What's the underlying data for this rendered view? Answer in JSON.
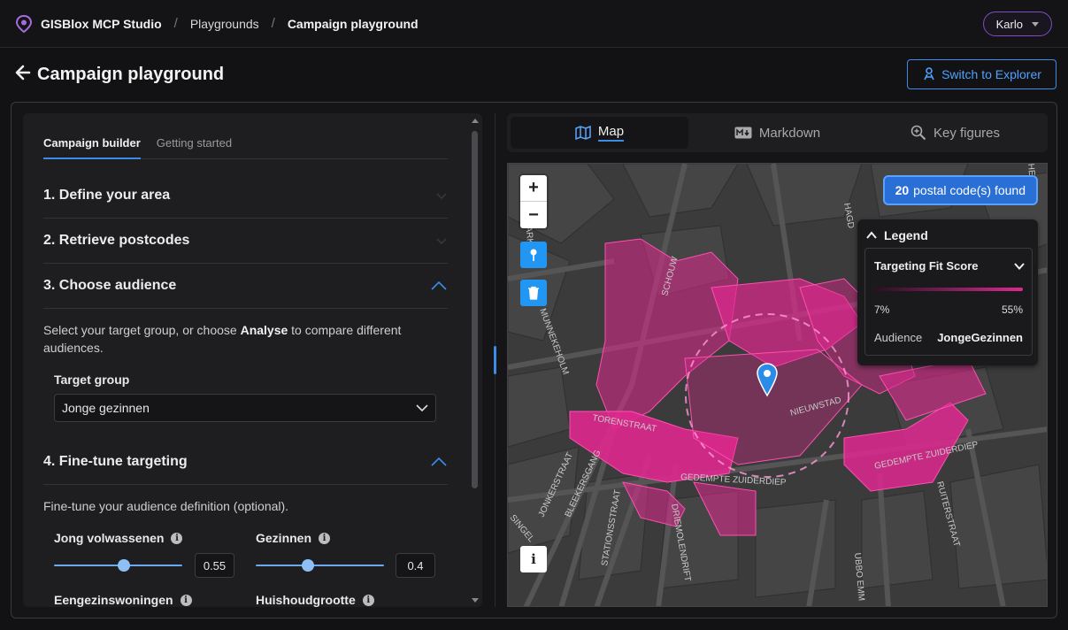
{
  "topbar": {
    "brand": "GISBlox MCP Studio",
    "crumbs": [
      "Playgrounds",
      "Campaign playground"
    ],
    "user": "Karlo"
  },
  "header": {
    "title": "Campaign playground",
    "explorer_button": "Switch to Explorer"
  },
  "builder": {
    "tabs": [
      "Campaign builder",
      "Getting started"
    ],
    "sections": [
      "1. Define your area",
      "2. Retrieve postcodes",
      "3. Choose audience",
      "4. Fine-tune targeting"
    ],
    "audience_desc_pre": "Select your target group, or choose ",
    "audience_desc_bold": "Analyse",
    "audience_desc_post": " to compare different audiences.",
    "target_group_label": "Target group",
    "target_group_value": "Jonge gezinnen",
    "finetune_desc": "Fine-tune your audience definition (optional).",
    "sliders": [
      {
        "label": "Jong volwassenen",
        "value": "0.55",
        "fraction": 0.55
      },
      {
        "label": "Gezinnen",
        "value": "0.4",
        "fraction": 0.4
      }
    ],
    "more_labels": [
      "Eengezinswoningen",
      "Huishoudgrootte"
    ]
  },
  "view_tabs": [
    "Map",
    "Markdown",
    "Key figures"
  ],
  "map": {
    "zoom_in": "+",
    "zoom_out": "−",
    "info": "i",
    "found_count": "20",
    "found_text": "postal code(s) found",
    "legend_title": "Legend",
    "legend_metric": "Targeting Fit Score",
    "legend_min": "7%",
    "legend_max": "55%",
    "audience_label": "Audience",
    "audience_value": "JongeGezinnen",
    "streets": [
      "MUNNEKEHOLM",
      "SCHOUW",
      "TORENSTRAAT",
      "GEDEMPTE ZUIDERDIEP",
      "NIEUWSTAD",
      "GEDEMPTE ZUIDERDIEP",
      "JONKERSTRAAT",
      "BLEEKERSGANG",
      "STATIONSSTRAAT",
      "DRIEMOLENDRIFT",
      "UBBO EMM",
      "RUITERSTRAAT",
      "HAGD",
      "PARK",
      "SINGEL",
      "HERE"
    ]
  },
  "colors": {
    "accent": "#3b8ce8",
    "fill": "#e0288f",
    "user_border": "#7c4dc4"
  }
}
